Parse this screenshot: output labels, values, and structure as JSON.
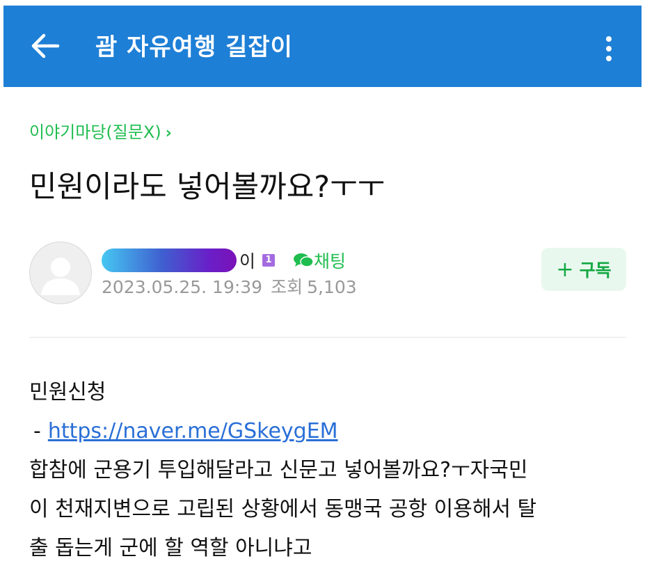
{
  "app_bar": {
    "title": "괌 자유여행 길잡이",
    "back_icon": "arrow-left-icon",
    "more_icon": "vertical-dots-icon",
    "color": "#1e7fd6"
  },
  "post": {
    "category": "이야기마당(질문X)",
    "title": "민원이라도 넣어볼까요?ㅜㅜ",
    "author": {
      "name_suffix": "이",
      "level_badge": "1",
      "chat_label": "채팅"
    },
    "date": "2023.05.25. 19:39",
    "views_label": "조회",
    "views_count": "5,103",
    "subscribe_label": "구독",
    "body": {
      "line1": "민원신청",
      "link_prefix": "-",
      "link": "https://naver.me/GSkeygEM",
      "line3": "합참에 군용기 투입해달라고 신문고 넣어볼까요?ㅜ자국민",
      "line4": "이 천재지변으로 고립된 상황에서 동맹국 공항 이용해서 탈",
      "line5": "출 돕는게 군에 할 역할 아니냐고"
    }
  },
  "colors": {
    "accent_green": "#1fbd4e",
    "link_blue": "#2a6fd6",
    "meta_gray": "#999999"
  }
}
